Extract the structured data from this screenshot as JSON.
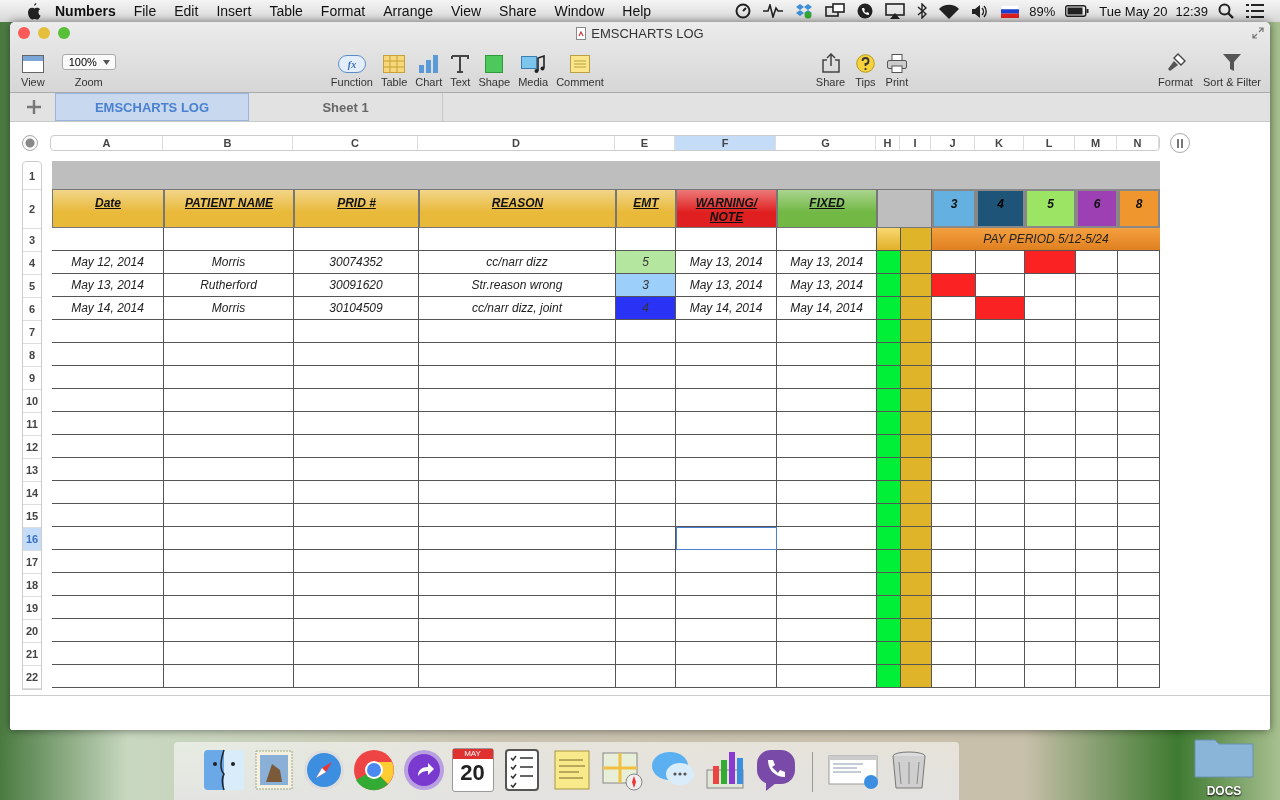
{
  "menu_bar": {
    "app": "Numbers",
    "menus": [
      "File",
      "Edit",
      "Insert",
      "Table",
      "Format",
      "Arrange",
      "View",
      "Share",
      "Window",
      "Help"
    ],
    "battery": "89%",
    "date": "Tue May 20",
    "time": "12:39"
  },
  "window": {
    "title": "EMSCHARTS LOG"
  },
  "toolbar": {
    "view": "View",
    "zoom_value": "100%",
    "zoom": "Zoom",
    "insert": [
      {
        "kind": "function",
        "label": "Function",
        "icon_text": "fx"
      },
      {
        "kind": "table",
        "label": "Table"
      },
      {
        "kind": "chart",
        "label": "Chart"
      },
      {
        "kind": "text",
        "label": "Text"
      },
      {
        "kind": "shape",
        "label": "Shape"
      },
      {
        "kind": "media",
        "label": "Media"
      },
      {
        "kind": "comment",
        "label": "Comment"
      }
    ],
    "share": [
      {
        "kind": "share",
        "label": "Share"
      },
      {
        "kind": "tips",
        "label": "Tips"
      },
      {
        "kind": "print",
        "label": "Print"
      }
    ],
    "format": [
      {
        "kind": "format",
        "label": "Format"
      },
      {
        "kind": "filter",
        "label": "Sort & Filter"
      }
    ]
  },
  "sheet_tabs": [
    {
      "label": "EMSCHARTS LOG",
      "selected": true
    },
    {
      "label": "Sheet 1",
      "selected": false
    }
  ],
  "columns": [
    {
      "label": "A",
      "selected": false
    },
    {
      "label": "B",
      "selected": false
    },
    {
      "label": "C",
      "selected": false
    },
    {
      "label": "D",
      "selected": false
    },
    {
      "label": "E",
      "selected": false
    },
    {
      "label": "F",
      "selected": true
    },
    {
      "label": "G",
      "selected": false
    },
    {
      "label": "H",
      "selected": false
    },
    {
      "label": "I",
      "selected": false
    },
    {
      "label": "J",
      "selected": false
    },
    {
      "label": "K",
      "selected": false
    },
    {
      "label": "L",
      "selected": false
    },
    {
      "label": "M",
      "selected": false
    },
    {
      "label": "N",
      "selected": false
    }
  ],
  "table": {
    "headers": [
      {
        "label": "Date",
        "color": "#e9b93a"
      },
      {
        "label": "PATIENT NAME",
        "color": "#e9b93a"
      },
      {
        "label": "PRID #",
        "color": "#e9b93a"
      },
      {
        "label": "REASON",
        "color": "#e9b93a"
      },
      {
        "label": "EMT",
        "color": "#e9b93a"
      },
      {
        "label": "WARNING/ NOTE",
        "color": "#e02020"
      },
      {
        "label": "FIXED",
        "color": "#72b845"
      }
    ],
    "emt_keys": [
      {
        "label": "3",
        "color": "#64b0e0"
      },
      {
        "label": "4",
        "color": "#1e5478"
      },
      {
        "label": "5",
        "color": "#9be464"
      },
      {
        "label": "6",
        "color": "#9c40b4"
      },
      {
        "label": "8",
        "color": "#f0962e"
      }
    ],
    "pay_period": "PAY PERIOD 5/12-5/24",
    "top_rows": [
      "1",
      "2",
      "3"
    ],
    "rows": [
      {
        "number": "4",
        "cells": [
          "May 12, 2014",
          "Morris",
          "30074352",
          "cc/narr dizz"
        ],
        "emt": {
          "label": "5",
          "color": "#b5e6a0"
        },
        "dates": [
          "May 13, 2014",
          "May 13, 2014"
        ],
        "flags": [
          false,
          false,
          true,
          false,
          false
        ],
        "selected": false
      },
      {
        "number": "5",
        "cells": [
          "May 13, 2014",
          "Rutherford",
          "30091620",
          "Str.reason wrong"
        ],
        "emt": {
          "label": "3",
          "color": "#9ccffa"
        },
        "dates": [
          "May 13, 2014",
          "May 13, 2014"
        ],
        "flags": [
          true,
          false,
          false,
          false,
          false
        ],
        "selected": false
      },
      {
        "number": "6",
        "cells": [
          "May 14, 2014",
          "Morris",
          "30104509",
          "cc/narr dizz, joint"
        ],
        "emt": {
          "label": "4",
          "color": "#2a33f5"
        },
        "dates": [
          "May 14, 2014",
          "May 14, 2014"
        ],
        "flags": [
          false,
          true,
          false,
          false,
          false
        ],
        "selected": false
      },
      {
        "number": "7",
        "flags": [
          false,
          false,
          false,
          false,
          false
        ],
        "selected": false
      },
      {
        "number": "8",
        "flags": [
          false,
          false,
          false,
          false,
          false
        ],
        "selected": false
      },
      {
        "number": "9",
        "flags": [
          false,
          false,
          false,
          false,
          false
        ],
        "selected": false
      },
      {
        "number": "10",
        "flags": [
          false,
          false,
          false,
          false,
          false
        ],
        "selected": false
      },
      {
        "number": "11",
        "flags": [
          false,
          false,
          false,
          false,
          false
        ],
        "selected": false
      },
      {
        "number": "12",
        "flags": [
          false,
          false,
          false,
          false,
          false
        ],
        "selected": false
      },
      {
        "number": "13",
        "flags": [
          false,
          false,
          false,
          false,
          false
        ],
        "selected": false
      },
      {
        "number": "14",
        "flags": [
          false,
          false,
          false,
          false,
          false
        ],
        "selected": false
      },
      {
        "number": "15",
        "flags": [
          false,
          false,
          false,
          false,
          false
        ],
        "selected": false
      },
      {
        "number": "16",
        "flags": [
          false,
          false,
          false,
          false,
          false
        ],
        "selected": true
      },
      {
        "number": "17",
        "flags": [
          false,
          false,
          false,
          false,
          false
        ],
        "selected": false
      },
      {
        "number": "18",
        "flags": [
          false,
          false,
          false,
          false,
          false
        ],
        "selected": false
      },
      {
        "number": "19",
        "flags": [
          false,
          false,
          false,
          false,
          false
        ],
        "selected": false
      },
      {
        "number": "20",
        "flags": [
          false,
          false,
          false,
          false,
          false
        ],
        "selected": false
      },
      {
        "number": "21",
        "flags": [
          false,
          false,
          false,
          false,
          false
        ],
        "selected": false
      },
      {
        "number": "22",
        "flags": [
          false,
          false,
          false,
          false,
          false
        ],
        "selected": false
      }
    ]
  },
  "dock": {
    "calendar_month": "MAY",
    "calendar_day": "20"
  },
  "desktop": {
    "folder": "DOCS"
  }
}
